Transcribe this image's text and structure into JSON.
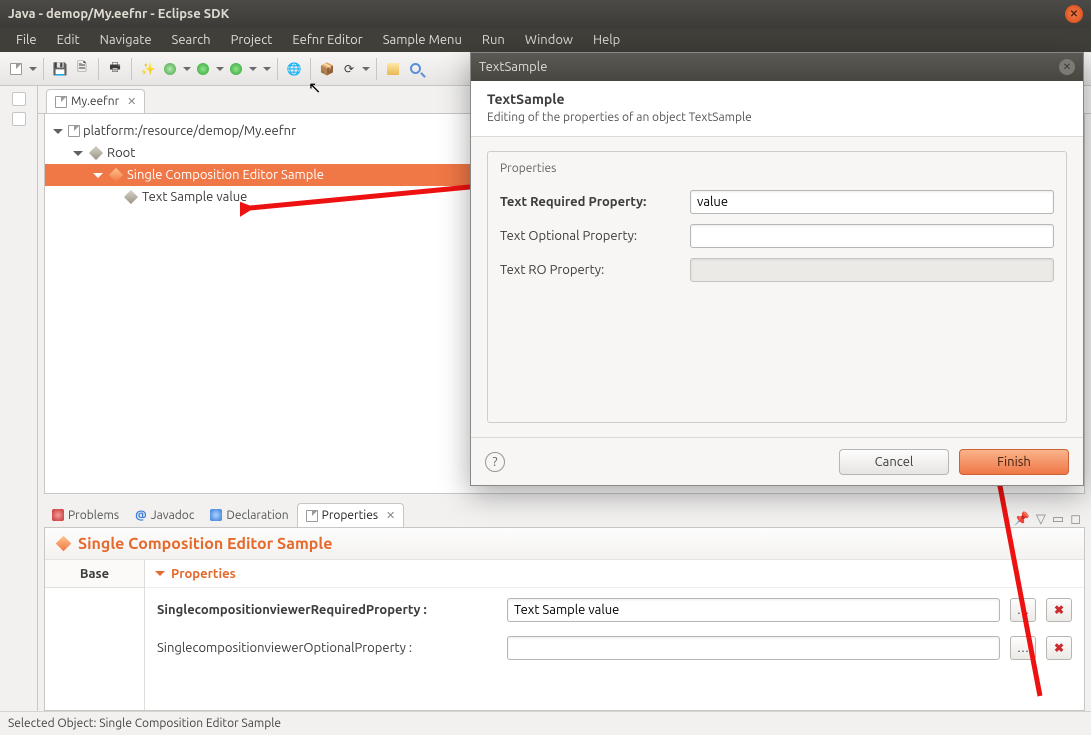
{
  "titlebar": {
    "title": "Java - demop/My.eefnr - Eclipse SDK"
  },
  "menubar": [
    "File",
    "Edit",
    "Navigate",
    "Search",
    "Project",
    "Eefnr Editor",
    "Sample Menu",
    "Run",
    "Window",
    "Help"
  ],
  "editor": {
    "tab_label": "My.eefnr",
    "tree": {
      "root_path": "platform:/resource/demop/My.eefnr",
      "root_node": "Root",
      "selected_node": "Single Composition Editor Sample",
      "child_node": "Text Sample value"
    }
  },
  "views": {
    "tabs": [
      "Problems",
      "Javadoc",
      "Declaration",
      "Properties"
    ],
    "active": "Properties"
  },
  "properties_view": {
    "title": "Single Composition Editor Sample",
    "sidebar_item": "Base",
    "sub_header": "Properties",
    "rows": [
      {
        "label": "SinglecompositionviewerRequiredProperty :",
        "value": "Text Sample value",
        "bold": true
      },
      {
        "label": "SinglecompositionviewerOptionalProperty :",
        "value": "",
        "bold": false
      }
    ]
  },
  "dialog": {
    "window_title": "TextSample",
    "heading": "TextSample",
    "subheading": "Editing of the properties of an object TextSample",
    "group_label": "Properties",
    "fields": {
      "required": {
        "label": "Text Required Property:",
        "value": "value"
      },
      "optional": {
        "label": "Text Optional Property:",
        "value": ""
      },
      "readonly": {
        "label": "Text RO Property:",
        "value": ""
      }
    },
    "buttons": {
      "cancel": "Cancel",
      "finish": "Finish"
    }
  },
  "statusbar": "Selected Object: Single Composition Editor Sample"
}
